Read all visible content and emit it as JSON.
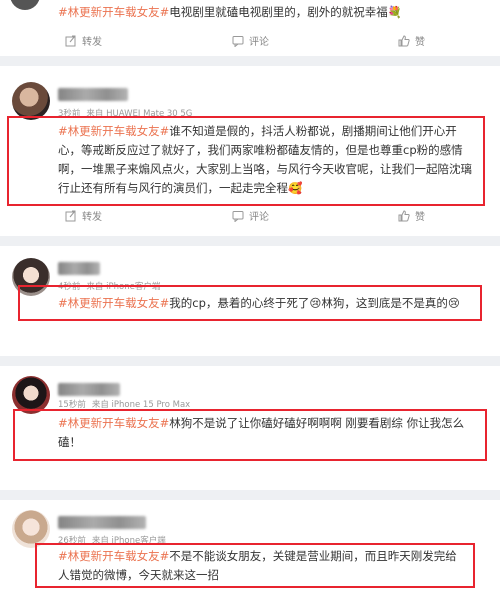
{
  "post0": {
    "tag": "#林更新开车载女友#",
    "text": "电视剧里就磕电视剧里的，剧外的就祝幸福",
    "emoji": "💐",
    "repost": "转发",
    "comment": "评论",
    "like": "赞"
  },
  "post1": {
    "time": "3秒前",
    "source": "来自 HUAWEI Mate 30 5G",
    "tag": "#林更新开车载女友#",
    "text": "谁不知道是假的，抖活人粉都说，剧播期间让他们开心开心，等戒断反应过了就好了，我们两家唯粉都磕友情的，但是也尊重cp粉的感情啊，一堆黑子来煽风点火，大家别上当咯，与风行今天收官呢，让我们一起陪沈璃行止还有所有与风行的演员们，一起走完全程",
    "emoji": "🥰",
    "repost": "转发",
    "comment": "评论",
    "like": "赞"
  },
  "post2": {
    "time": "4秒前",
    "source": "来自 iPhone客户端",
    "tag": "#林更新开车载女友#",
    "text": "我的cp，悬着的心终于死了",
    "emoji1": "😢",
    "text2": "林狗，这到底是不是真的",
    "emoji2": "😢"
  },
  "post3": {
    "time": "15秒前",
    "source": "来自 iPhone 15 Pro Max",
    "tag": "#林更新开车载女友#",
    "text": "林狗不是说了让你磕好磕好啊啊啊 刚要看剧综 你让我怎么磕！"
  },
  "post4": {
    "time": "26秒前",
    "source": "来自 iPhone客户端",
    "tag": "#林更新开车载女友#",
    "text": "不是不能谈女朋友，关键是营业期间，而且昨天刚发完给人错觉的微博，今天就来这一招"
  }
}
